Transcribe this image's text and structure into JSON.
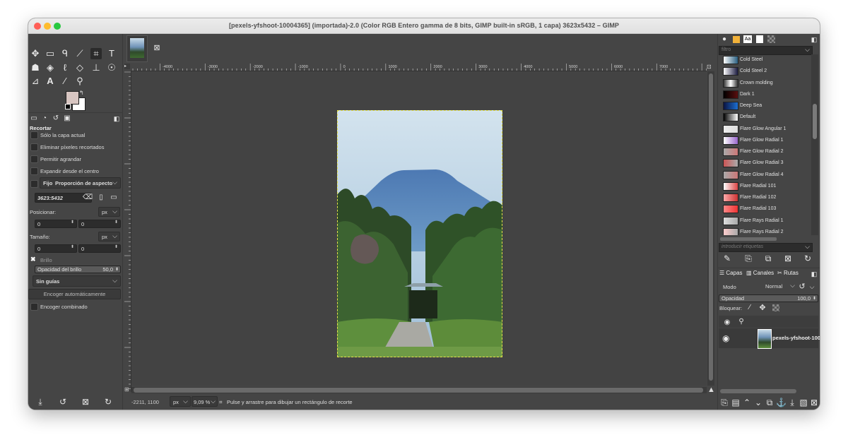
{
  "window": {
    "title": "[pexels-yfshoot-10004365] (importada)-2.0 (Color RGB Entero gamma de 8 bits, GIMP built-in sRGB, 1 capa) 3623x5432 – GIMP"
  },
  "colors": {
    "close": "#ff5f57",
    "minimize": "#febc2e",
    "maximize": "#28c840",
    "fg_color": "#d8c6c2",
    "bg_color": "#ffffff"
  },
  "tool_options": {
    "title": "Recortar",
    "current_layer_only": "Sólo la capa actual",
    "delete_cropped": "Eliminar píxeles recortados",
    "allow_growing": "Permitir agrandar",
    "expand_from_center": "Expandir desde el centro",
    "fixed_label": "Fijo",
    "fixed_value": "Proporción de aspecto",
    "ratio_value": "3623:5432",
    "position_label": "Posicionar:",
    "position_unit": "px",
    "position_x": "0",
    "position_y": "0",
    "size_label": "Tamaño:",
    "size_unit": "px",
    "size_w": "0",
    "size_h": "0",
    "highlight_label": "Brillo",
    "highlight_opacity_label": "Opacidad del brillo",
    "highlight_opacity_value": "50,0",
    "guides_value": "Sin guías",
    "auto_shrink": "Encoger automáticamente",
    "shrink_merged": "Encoger combinado"
  },
  "ruler": {
    "labels": [
      "-4000",
      "-3000",
      "-2000",
      "-1000",
      "0",
      "1000",
      "2000",
      "3000",
      "4000",
      "5000",
      "6000",
      "7000"
    ]
  },
  "statusbar": {
    "coords": "-2211, 1100",
    "unit": "px",
    "zoom": "9,09 %",
    "message": "Pulse y arrastre para dibujar un rectángulo de recorte"
  },
  "gradients": {
    "filter_placeholder": "filtro",
    "items": [
      {
        "name": "Cold Steel"
      },
      {
        "name": "Cold Steel 2"
      },
      {
        "name": "Crown molding"
      },
      {
        "name": "Dark 1"
      },
      {
        "name": "Deep Sea"
      },
      {
        "name": "Default"
      },
      {
        "name": "Flare Glow Angular 1"
      },
      {
        "name": "Flare Glow Radial 1"
      },
      {
        "name": "Flare Glow Radial 2"
      },
      {
        "name": "Flare Glow Radial 3"
      },
      {
        "name": "Flare Glow Radial 4"
      },
      {
        "name": "Flare Radial 101"
      },
      {
        "name": "Flare Radial 102"
      },
      {
        "name": "Flare Radial 103"
      },
      {
        "name": "Flare Rays Radial 1"
      },
      {
        "name": "Flare Rays Radial 2"
      }
    ],
    "tags_placeholder": "introducir etiquetas"
  },
  "layers": {
    "tab_layers": "Capas",
    "tab_channels": "Canales",
    "tab_paths": "Rutas",
    "mode_label": "Modo",
    "mode_value": "Normal",
    "opacity_label": "Opacidad",
    "opacity_value": "100,0",
    "lock_label": "Bloquear:",
    "layer_name": "pexels-yfshoot-100"
  }
}
